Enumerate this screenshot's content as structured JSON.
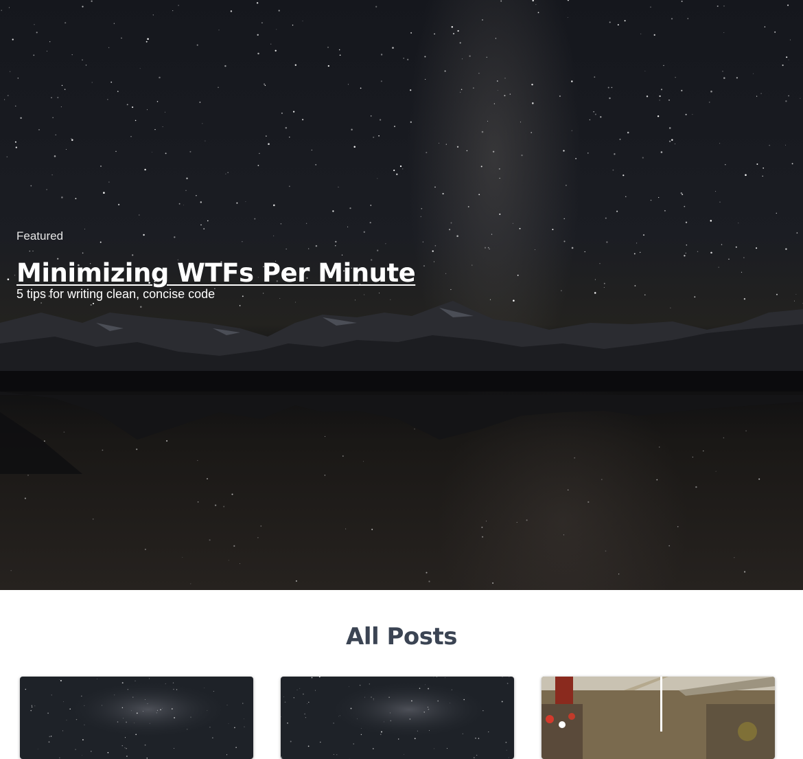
{
  "featured": {
    "label": "Featured",
    "title": "Minimizing WTFs Per Minute",
    "subtitle": "5 tips for writing clean, concise code"
  },
  "posts": {
    "heading": "All Posts",
    "cards": [
      {
        "thumbnail": "starry-sky-image"
      },
      {
        "thumbnail": "starry-sky-image"
      },
      {
        "thumbnail": "market-interior-image"
      }
    ]
  },
  "colors": {
    "heading": "#3b4453",
    "hero_text": "#ffffff"
  }
}
